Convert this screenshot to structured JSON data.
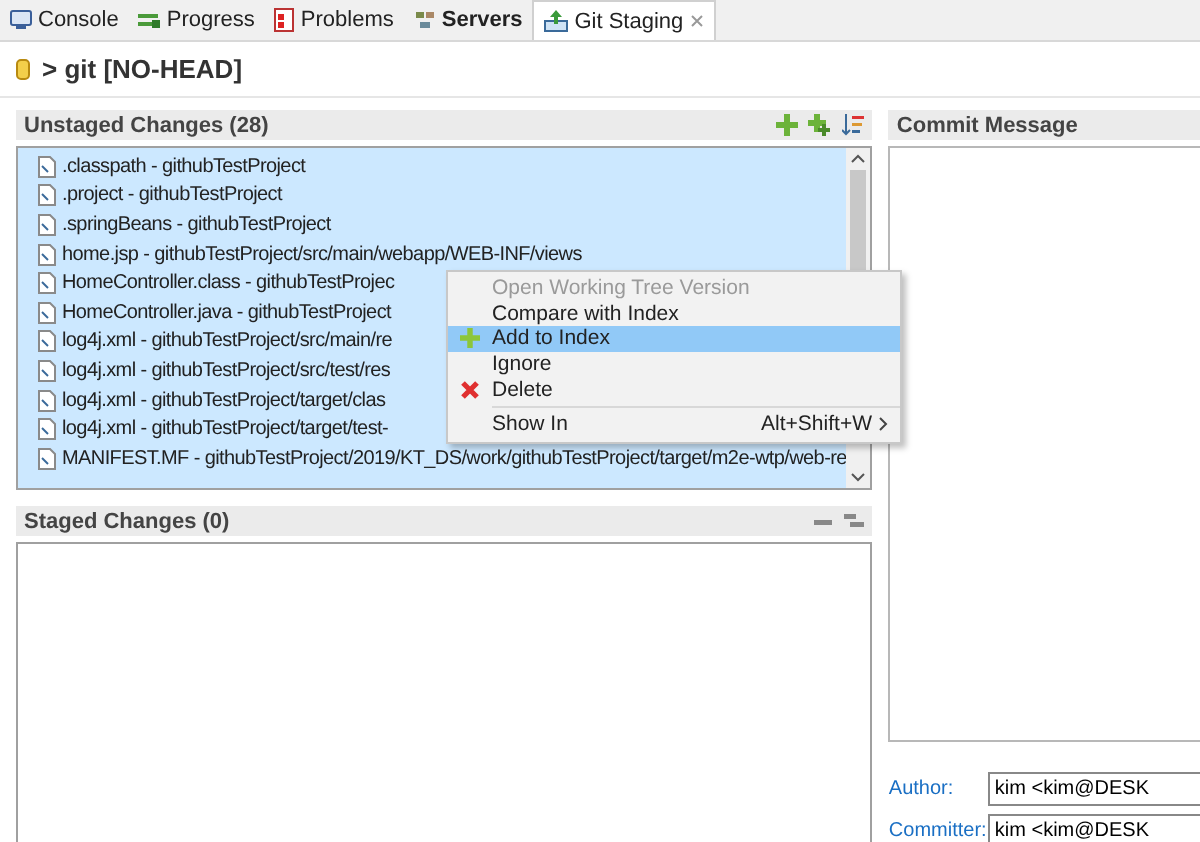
{
  "tabs": [
    {
      "label": "Console",
      "selected": false,
      "bold": false,
      "closable": false
    },
    {
      "label": "Progress",
      "selected": false,
      "bold": false,
      "closable": false
    },
    {
      "label": "Problems",
      "selected": false,
      "bold": false,
      "closable": false
    },
    {
      "label": "Servers",
      "selected": false,
      "bold": true,
      "closable": false
    },
    {
      "label": "Git Staging",
      "selected": true,
      "bold": false,
      "closable": true
    }
  ],
  "repository": {
    "title": "> git [NO-HEAD]"
  },
  "unstaged": {
    "title": "Unstaged Changes (28)",
    "rows": [
      {
        "text": ".classpath - githubTestProject",
        "selected": true
      },
      {
        "text": ".project - githubTestProject",
        "selected": true
      },
      {
        "text": ".springBeans - githubTestProject",
        "selected": true
      },
      {
        "text": "home.jsp - githubTestProject/src/main/webapp/WEB-INF/views",
        "selected": true
      },
      {
        "text": "HomeController.class - githubTestProjec",
        "selected": true
      },
      {
        "text": "HomeController.java - githubTestProject",
        "selected": true
      },
      {
        "text": "log4j.xml - githubTestProject/src/main/re",
        "selected": true
      },
      {
        "text": "log4j.xml - githubTestProject/src/test/res",
        "selected": true
      },
      {
        "text": "log4j.xml - githubTestProject/target/clas",
        "selected": true
      },
      {
        "text": "log4j.xml - githubTestProject/target/test-",
        "selected": true
      },
      {
        "text": "MANIFEST.MF - githubTestProject/2019/KT_DS/work/githubTestProject/target/m2e-wtp/web-re",
        "selected": true
      }
    ]
  },
  "context_menu": {
    "items": [
      {
        "kind": "item",
        "label": "Open Working Tree Version",
        "disabled": true,
        "selected": false
      },
      {
        "kind": "item",
        "label": "Compare with Index",
        "disabled": false,
        "selected": false
      },
      {
        "kind": "add",
        "label": "Add to Index",
        "disabled": false,
        "selected": true
      },
      {
        "kind": "item",
        "label": "Ignore",
        "disabled": false,
        "selected": false
      },
      {
        "kind": "delete",
        "label": "Delete",
        "disabled": false,
        "selected": false
      },
      {
        "kind": "separator"
      },
      {
        "kind": "submenu",
        "label": "Show In",
        "shortcut": "Alt+Shift+W",
        "disabled": false,
        "selected": false
      }
    ]
  },
  "staged": {
    "title": "Staged Changes (0)"
  },
  "commit": {
    "title": "Commit Message",
    "author_label": "Author:",
    "author": "kim <kim@DESK",
    "committer_label": "Committer:",
    "committer": "kim <kim@DESK"
  }
}
